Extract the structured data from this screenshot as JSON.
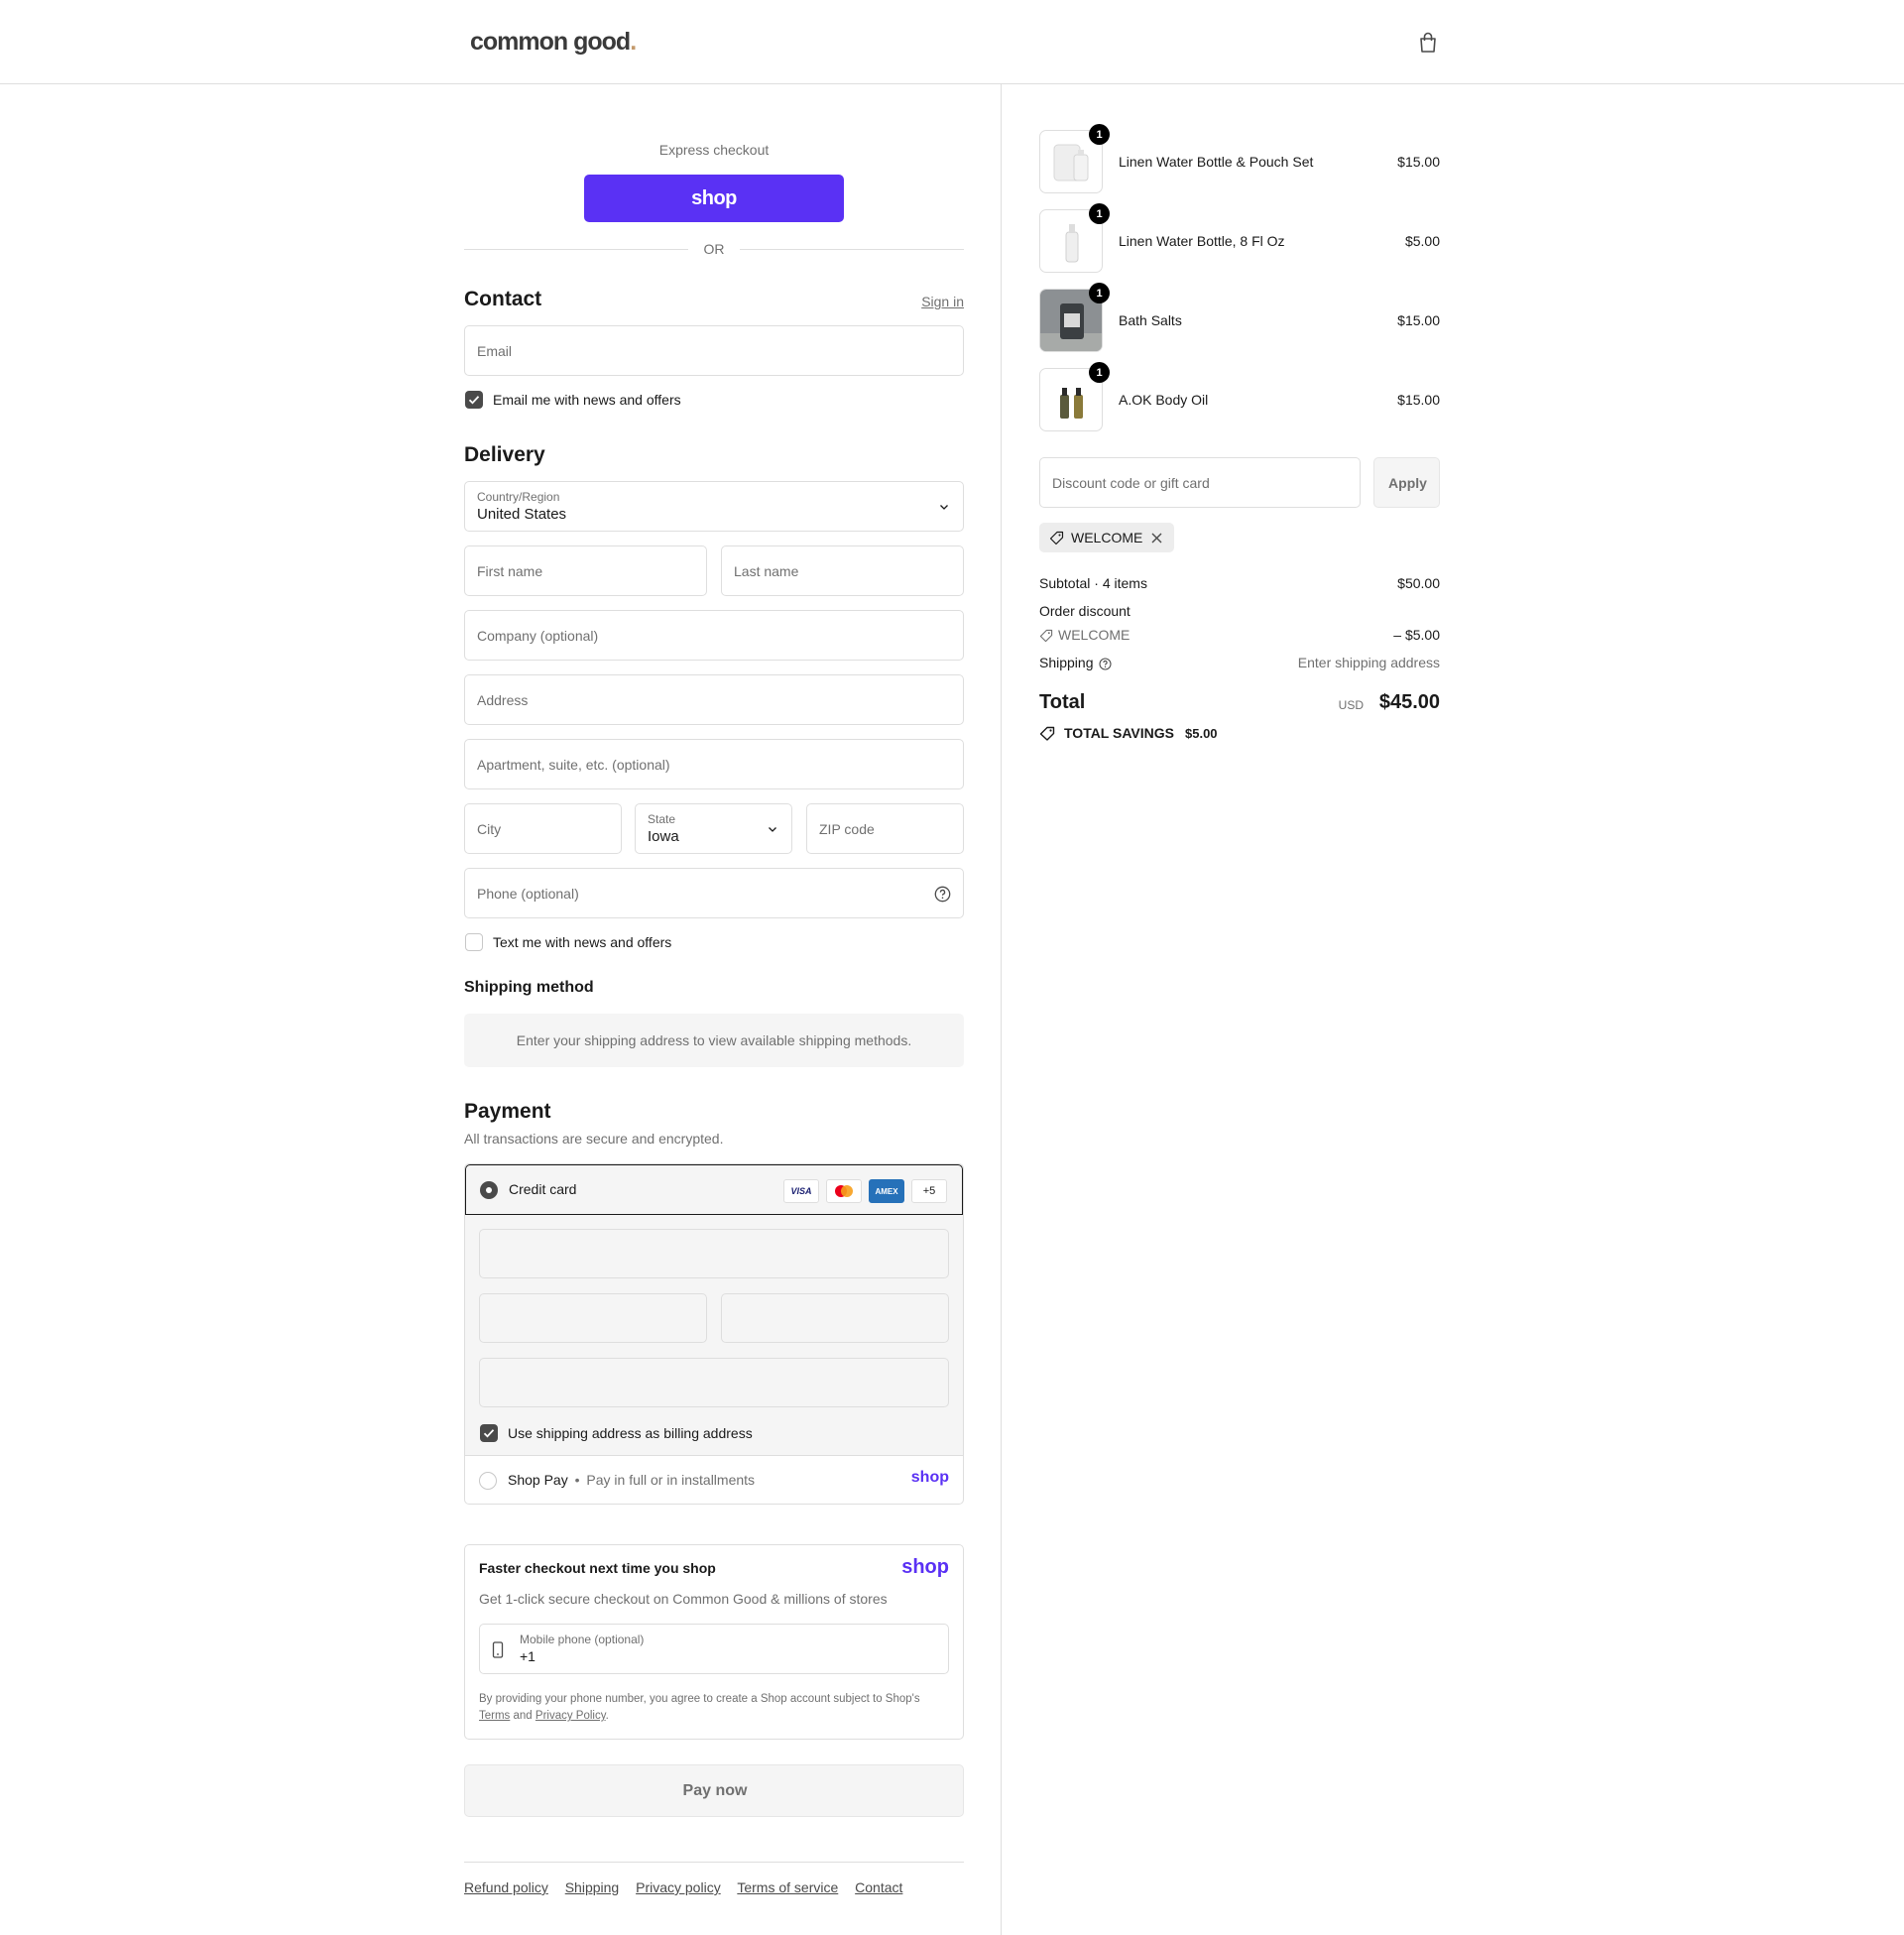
{
  "header": {
    "logo": "common good",
    "logo_dot": "."
  },
  "express": {
    "label": "Express checkout",
    "shop_button": "shop",
    "or": "OR"
  },
  "contact": {
    "title": "Contact",
    "sign_in": "Sign in",
    "email_placeholder": "Email",
    "email_news": "Email me with news and offers"
  },
  "delivery": {
    "title": "Delivery",
    "country_label": "Country/Region",
    "country_value": "United States",
    "first_name": "First name",
    "last_name": "Last name",
    "company": "Company (optional)",
    "address": "Address",
    "apartment": "Apartment, suite, etc. (optional)",
    "city": "City",
    "state_label": "State",
    "state_value": "Iowa",
    "zip": "ZIP code",
    "phone": "Phone (optional)",
    "text_news": "Text me with news and offers"
  },
  "shipping_method": {
    "title": "Shipping method",
    "message": "Enter your shipping address to view available shipping methods."
  },
  "payment": {
    "title": "Payment",
    "subtitle": "All transactions are secure and encrypted.",
    "credit_card": "Credit card",
    "cards": [
      "VISA",
      "AMEX",
      "+5"
    ],
    "billing_same": "Use shipping address as billing address",
    "shop_pay": "Shop Pay",
    "shop_pay_sep": "•",
    "shop_pay_desc": "Pay in full or in installments",
    "shop_logo": "shop"
  },
  "faster": {
    "title": "Faster checkout next time you shop",
    "shop_logo": "shop",
    "desc": "Get 1-click secure checkout on Common Good & millions of stores",
    "phone_label": "Mobile phone (optional)",
    "phone_value": "+1",
    "legal_1": "By providing your phone number, you agree to create a Shop account subject to Shop's",
    "terms": "Terms",
    "and": "and",
    "privacy": "Privacy Policy",
    "period": "."
  },
  "pay_now": "Pay now",
  "footer_links": [
    "Refund policy",
    "Shipping",
    "Privacy policy",
    "Terms of service",
    "Contact"
  ],
  "cart": {
    "items": [
      {
        "name": "Linen Water Bottle & Pouch Set",
        "price": "$15.00",
        "qty": "1"
      },
      {
        "name": "Linen Water Bottle, 8 Fl Oz",
        "price": "$5.00",
        "qty": "1"
      },
      {
        "name": "Bath Salts",
        "price": "$15.00",
        "qty": "1"
      },
      {
        "name": "A.OK Body Oil",
        "price": "$15.00",
        "qty": "1"
      }
    ],
    "discount_placeholder": "Discount code or gift card",
    "apply": "Apply",
    "applied_code": "WELCOME",
    "subtotal_label": "Subtotal · 4 items",
    "subtotal": "$50.00",
    "order_discount_label": "Order discount",
    "discount_code": "WELCOME",
    "discount_amount": "– $5.00",
    "shipping_label": "Shipping",
    "shipping_value": "Enter shipping address",
    "total_label": "Total",
    "currency": "USD",
    "total": "$45.00",
    "savings_label": "TOTAL SAVINGS",
    "savings": "$5.00"
  },
  "colors": {
    "shop_purple": "#5a31f4",
    "text": "#1a1a1a",
    "muted": "#707070",
    "border": "#dedede"
  }
}
